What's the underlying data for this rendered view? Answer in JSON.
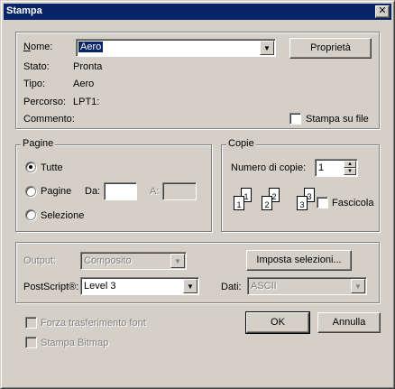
{
  "window": {
    "title": "Stampa",
    "close_glyph": "✕"
  },
  "printer": {
    "name_label": "Nome:",
    "name_value": "Aero",
    "properties_button": "Proprietà",
    "status_label": "Stato:",
    "status_value": "Pronta",
    "type_label": "Tipo:",
    "type_value": "Aero",
    "path_label": "Percorso:",
    "path_value": "LPT1:",
    "comment_label": "Commento:",
    "print_to_file_label": "Stampa su file",
    "print_to_file_checked": false
  },
  "pages": {
    "legend": "Pagine",
    "all_label": "Tutte",
    "pages_label": "Pagine",
    "from_label": "Da:",
    "to_label": "A:",
    "from_value": "",
    "to_value": "",
    "selection_label": "Selezione",
    "selected": "all"
  },
  "copies": {
    "legend": "Copie",
    "count_label": "Numero di copie:",
    "count_value": "1",
    "collate_label": "Fascicola",
    "collate_checked": false,
    "icon_numbers": [
      "1",
      "1",
      "2",
      "2",
      "3",
      "3"
    ]
  },
  "output": {
    "output_label": "Output:",
    "output_value": "Composito",
    "setup_button": "Imposta selezioni...",
    "postscript_label": "PostScript®:",
    "postscript_value": "Level 3",
    "data_label": "Dati:",
    "data_value": "ASCII"
  },
  "options": {
    "force_font_label": "Forza trasferimento font",
    "print_bitmap_label": "Stampa Bitmap"
  },
  "buttons": {
    "ok": "OK",
    "cancel": "Annulla"
  },
  "icons": {
    "radio_dot": "radio-selected",
    "dropdown": "chevron-down-icon"
  }
}
